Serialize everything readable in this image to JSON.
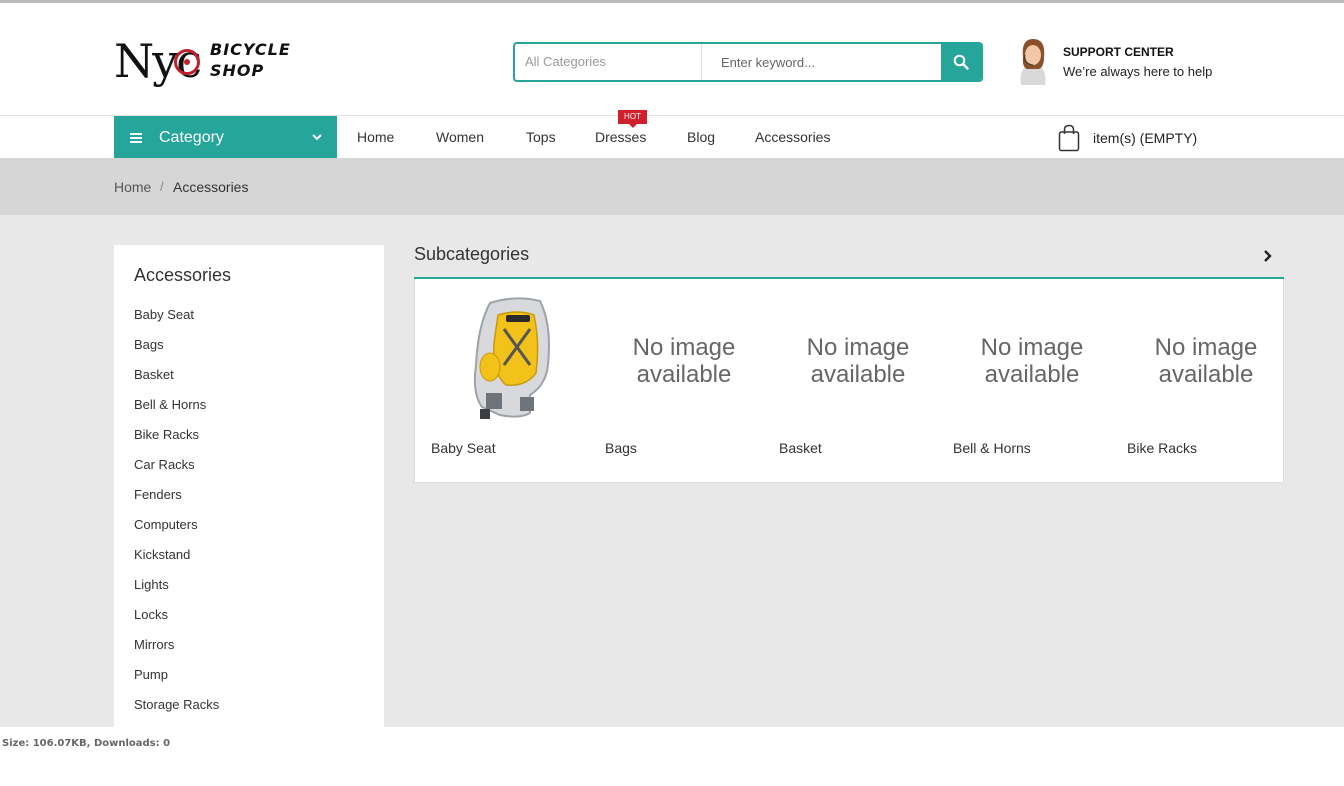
{
  "header": {
    "logo_main": "Nyc",
    "logo_line1": "BICYCLE",
    "logo_line2": "SHOP",
    "search": {
      "category": "All Categories",
      "placeholder": "Enter keyword..."
    },
    "support": {
      "title": "SUPPORT CENTER",
      "subtitle": "We’re always here to help"
    }
  },
  "nav": {
    "category_label": "Category",
    "items": [
      "Home",
      "Women",
      "Tops",
      "Dresses",
      "Blog",
      "Accessories"
    ],
    "hot_badge": "HOT",
    "cart_text": "item(s) (EMPTY)"
  },
  "breadcrumb": {
    "home": "Home",
    "separator": "/",
    "current": "Accessories"
  },
  "sidebar": {
    "title": "Accessories",
    "items": [
      "Baby Seat",
      "Bags",
      "Basket",
      "Bell & Horns",
      "Bike Racks",
      "Car Racks",
      "Fenders",
      "Computers",
      "Kickstand",
      "Lights",
      "Locks",
      "Mirrors",
      "Pump",
      "Storage Racks"
    ]
  },
  "subcategories": {
    "title": "Subcategories",
    "no_image_line1": "No image",
    "no_image_line2": "available",
    "items": [
      "Baby Seat",
      "Bags",
      "Basket",
      "Bell & Horns",
      "Bike Racks"
    ]
  },
  "footer": {
    "note": "Size: 106.07KB, Downloads: 0"
  },
  "colors": {
    "accent": "#26a69a",
    "hot": "#d0202e",
    "breadcrumb_bg": "#d6d6d6",
    "main_bg": "#e8e8e8"
  }
}
